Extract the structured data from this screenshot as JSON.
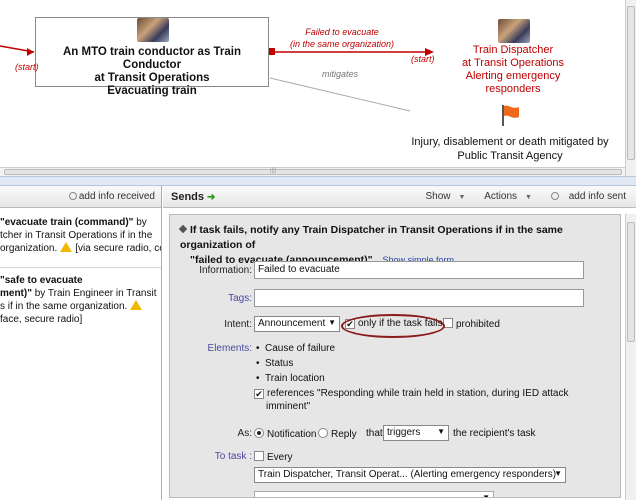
{
  "diagram": {
    "main_node": {
      "line1": "An MTO train conductor as Train Conductor",
      "line2": "at Transit Operations",
      "line3": "Evacuating train"
    },
    "start_label_left": "(start)",
    "start_label_right": "(start)",
    "flow_label_line1": "Failed to evacuate",
    "flow_label_line2": "(in the same organization)",
    "target_node": {
      "line1": "Train Dispatcher",
      "line2": "at Transit Operations",
      "line3": "Alerting emergency responders"
    },
    "mitigates_label": "mitigates",
    "risk_node": {
      "line1": "Injury, disablement or death mitigated by",
      "line2": "Public Transit Agency"
    },
    "colors": {
      "flow": "#c00000",
      "mitigate": "#999999"
    }
  },
  "received_panel": {
    "add_info_label": "add info received",
    "items": [
      {
        "line1_bold": "\"evacuate train (command)\"",
        "line1_rest": " by",
        "line2": "tcher in Transit Operations if in the",
        "line3": "organization.",
        "line3_extra": "[via secure radio, cell]"
      },
      {
        "line1_bold": "\"safe to evacuate",
        "line2_bold": "ment)\"",
        "line2_rest": " by Train Engineer in Transit",
        "line3": "s if in the same organization.",
        "line4": "face, secure radio]"
      }
    ]
  },
  "sends_panel": {
    "title": "Sends",
    "show_label": "Show",
    "actions_label": "Actions",
    "add_info_label": "add info sent",
    "task_title_line1": "If task fails, notify any Train Dispatcher in Transit Operations if in the same organization of",
    "task_title_line2": "\"failed to evacuate (announcement)\" .",
    "show_simple_form": "Show simple form",
    "information_label": "Information:",
    "information_value": "Failed to evacuate",
    "tags_label": "Tags:",
    "tags_value": "",
    "intent_label": "Intent:",
    "intent_value": "Announcement",
    "only_if_fails_label": "only if the task fails",
    "only_if_fails_checked": true,
    "prohibited_label": "prohibited",
    "prohibited_checked": false,
    "elements_label": "Elements:",
    "elements": [
      "Cause of failure",
      "Status",
      "Train location"
    ],
    "references_line1": "references \"Responding while train held in station, during IED attack",
    "references_line2": "imminent\"",
    "references_checked": true,
    "as_label": "As:",
    "notification_label": "Notification",
    "reply_label": "Reply",
    "that_label": "that",
    "triggers_value": "triggers",
    "recipient_task_label": "the recipient's task",
    "to_task_label": "To task :",
    "every_label": "Every",
    "to_task_value": "Train Dispatcher, Transit Operat... (Alerting emergency responders)"
  }
}
